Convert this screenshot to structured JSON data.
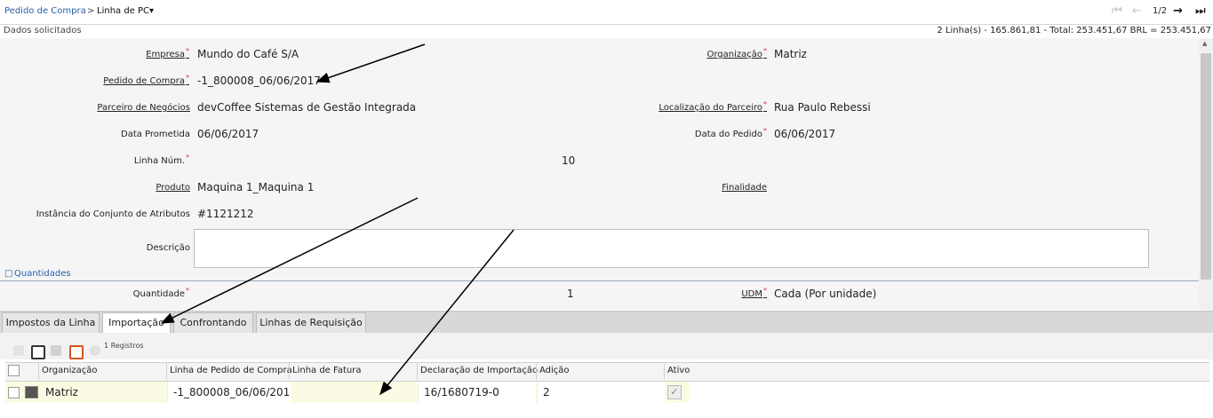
{
  "breadcrumb": {
    "parent": "Pedido de Compra",
    "separator": ">",
    "current": "Linha de PC",
    "caret": "▾"
  },
  "pager": {
    "text": "1/2"
  },
  "subheader": {
    "left": "Dados solicitados",
    "right": "2 Linha(s) - 165.861,81 - Total: 253.451,67 BRL = 253.451,67"
  },
  "form": {
    "empresa": {
      "label": "Empresa",
      "value": "Mundo do Café S/A"
    },
    "organizacao": {
      "label": "Organização",
      "value": "Matriz"
    },
    "pedido": {
      "label": "Pedido de Compra",
      "value": "-1_800008_06/06/2017"
    },
    "parceiro": {
      "label": "Parceiro de Negócios",
      "value": "devCoffee Sistemas de Gestão Integrada"
    },
    "localizacao": {
      "label": "Localização do Parceiro",
      "value": "Rua Paulo Rebessi"
    },
    "data_prometida": {
      "label": "Data Prometida",
      "value": "06/06/2017"
    },
    "data_pedido": {
      "label": "Data do Pedido",
      "value": "06/06/2017"
    },
    "linha_num": {
      "label": "Linha Núm.",
      "value": "10"
    },
    "produto": {
      "label": "Produto",
      "value": "Maquina 1_Maquina 1"
    },
    "finalidade": {
      "label": "Finalidade",
      "value": ""
    },
    "instancia": {
      "label": "Instância do Conjunto de Atributos",
      "value": "#1121212"
    },
    "descricao": {
      "label": "Descrição",
      "value": ""
    },
    "section_quantidades": "Quantidades",
    "quantidade": {
      "label": "Quantidade",
      "value": "1"
    },
    "udm": {
      "label": "UDM",
      "value": "Cada (Por unidade)"
    }
  },
  "tabs": [
    {
      "label": "Impostos da Linha"
    },
    {
      "label": "Importação"
    },
    {
      "label": "Confrontando"
    },
    {
      "label": "Linhas de Requisição"
    }
  ],
  "toolbar": {
    "records": "1 Registros"
  },
  "grid": {
    "columns": [
      "Organização",
      "Linha de Pedido de Compra",
      "Linha de Fatura",
      "Declaração de Importação",
      "Adição",
      "Ativo"
    ],
    "rows": [
      {
        "organizacao": "Matriz",
        "linha_pedido": "-1_800008_06/06/201",
        "linha_fatura": "",
        "declaracao": "16/1680719-0",
        "adicao": "2",
        "ativo": "✓"
      }
    ]
  },
  "colors": {
    "link": "#2a5ea8",
    "required": "#dd3333",
    "row_highlight": "#fbfbe3"
  }
}
